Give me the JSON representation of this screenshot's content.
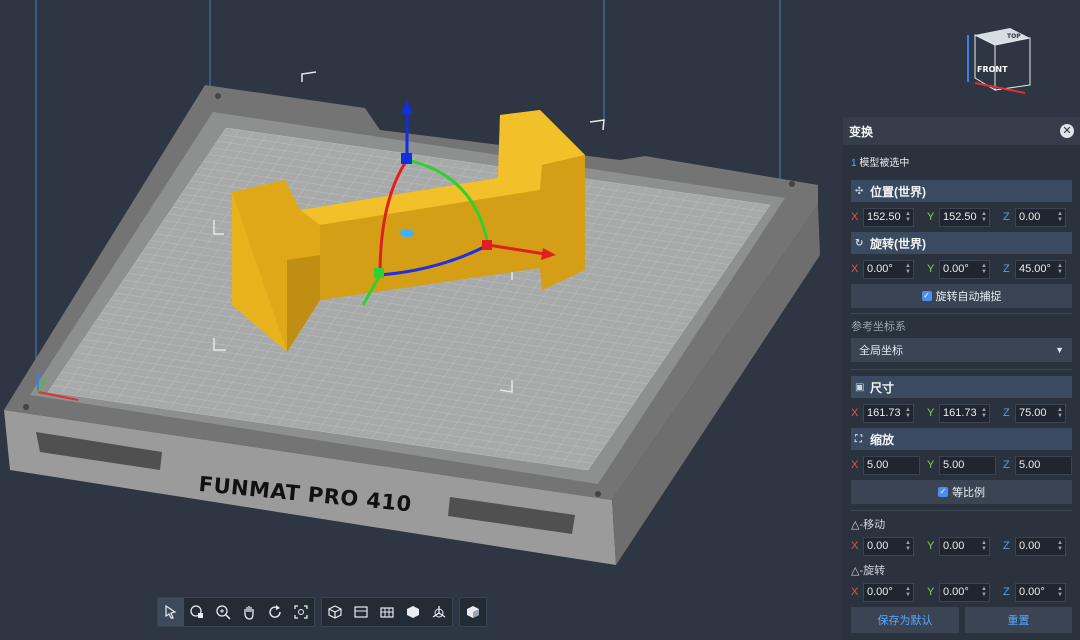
{
  "printer": {
    "bed_label": "FUNMAT PRO 410"
  },
  "navcube": {
    "top_label": "TOP",
    "front_label": "FRONT"
  },
  "toolbar": {
    "groups": [
      [
        "select-icon",
        "view-model-icon",
        "zoom-icon",
        "pan-hand-icon",
        "rotate-view-icon",
        "fit-view-icon"
      ],
      [
        "iso-view-icon",
        "front-view-icon",
        "grid-view-icon",
        "box-view-icon",
        "axes-view-icon"
      ],
      [
        "shading-icon"
      ]
    ]
  },
  "panel": {
    "title": "变换",
    "selection_count": "1",
    "selection_text": "模型被选中",
    "position": {
      "label": "位置(世界)",
      "x": "152.50",
      "y": "152.50",
      "z": "0.00"
    },
    "rotation": {
      "label": "旋转(世界)",
      "x": "0.00°",
      "y": "0.00°",
      "z": "45.00°"
    },
    "rotation_snap": "旋转自动捕捉",
    "ref_coord_label": "参考坐标系",
    "ref_coord_value": "全局坐标",
    "size": {
      "label": "尺寸",
      "x": "161.73",
      "y": "161.73",
      "z": "75.00"
    },
    "scale": {
      "label": "缩放",
      "x": "5.00",
      "y": "5.00",
      "z": "5.00"
    },
    "uniform_scale": "等比例",
    "delta_move": {
      "label": "△-移动",
      "x": "0.00",
      "y": "0.00",
      "z": "0.00"
    },
    "delta_rotate": {
      "label": "△-旋转",
      "x": "0.00°",
      "y": "0.00°",
      "z": "0.00°"
    },
    "save_default": "保存为默认",
    "reset": "重置",
    "axis_x": "X",
    "axis_y": "Y",
    "axis_z": "Z"
  },
  "colors": {
    "accent": "#4c8ef0",
    "model": "#e8b21c",
    "background": "#2d3642"
  }
}
